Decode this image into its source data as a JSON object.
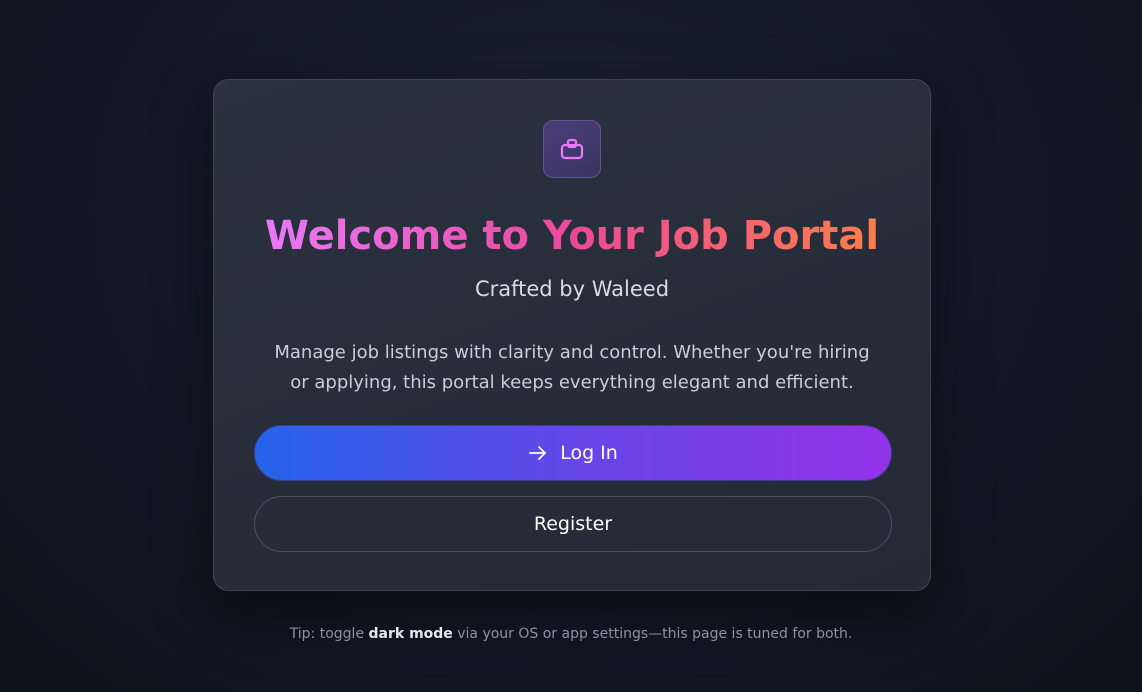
{
  "card": {
    "logo_icon": "briefcase-icon",
    "title": "Welcome to Your Job Portal",
    "subtitle": "Crafted by Waleed",
    "description": "Manage job listings with clarity and control. Whether you're hiring or applying, this portal keeps everything elegant and efficient.",
    "login_label": "Log In",
    "login_icon": "arrow-right-icon",
    "register_label": "Register"
  },
  "tip": {
    "prefix": "Tip: toggle ",
    "highlight": "dark mode",
    "suffix": " via your OS or app settings—this page is tuned for both."
  },
  "colors": {
    "title_gradient_start": "#e879f9",
    "title_gradient_mid": "#ec4899",
    "title_gradient_end": "#fb7e4a",
    "login_gradient_start": "#2563eb",
    "login_gradient_end": "#9333ea",
    "icon_accent": "#e879f9"
  }
}
